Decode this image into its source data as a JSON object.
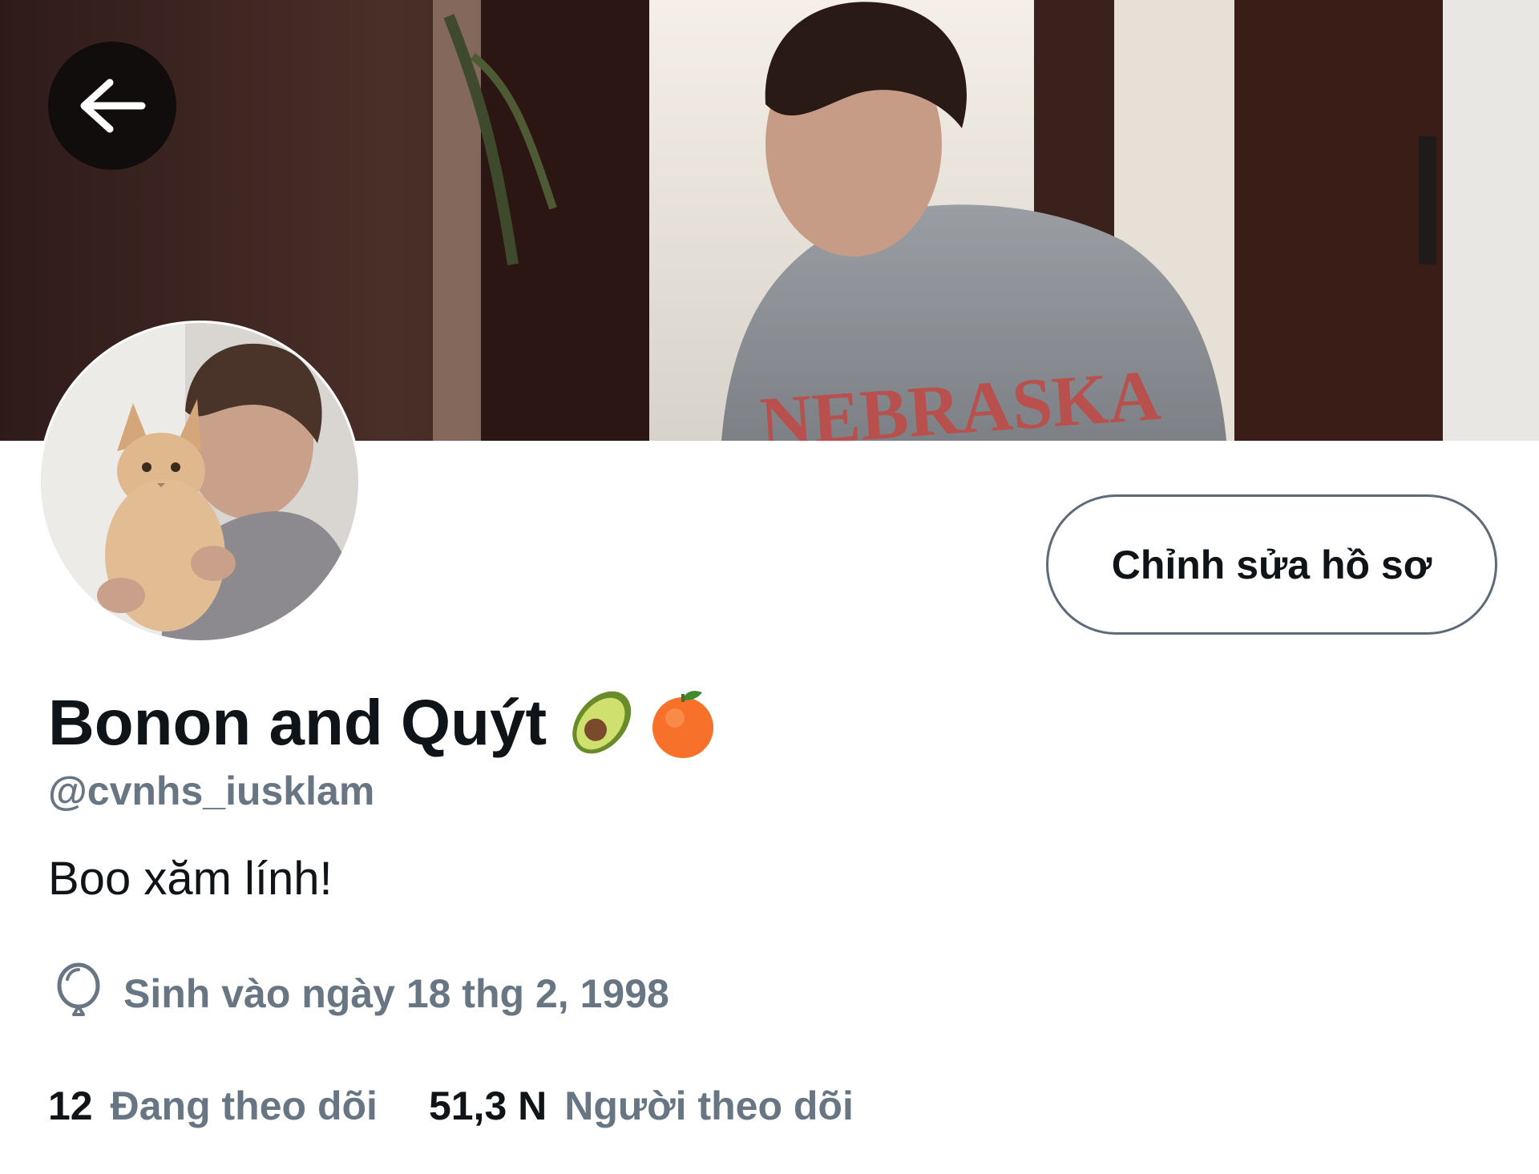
{
  "header": {
    "back_icon": "arrow-left-icon",
    "banner_image": "banner-photo (person in grey sweatshirt standing by window)",
    "banner_shirt_text": "NEBRASKA"
  },
  "profile": {
    "avatar_image": "avatar-photo (person holding orange kitten)",
    "edit_button_label": "Chỉnh sửa hồ sơ",
    "display_name": "Bonon and Quýt",
    "name_emojis": [
      "avocado-icon",
      "tangerine-icon"
    ],
    "handle": "@cvnhs_iusklam",
    "bio": "Boo xăm lính!",
    "birthday_icon": "balloon-icon",
    "birthday": "Sinh vào ngày 18 thg 2, 1998"
  },
  "stats": {
    "following_count": "12",
    "following_label": "Đang theo dõi",
    "followers_count": "51,3 N",
    "followers_label": "Người theo dõi"
  },
  "colors": {
    "primary_text": "#0f1419",
    "secondary_text": "#687684",
    "button_border": "#5d6b78",
    "background": "#ffffff"
  }
}
